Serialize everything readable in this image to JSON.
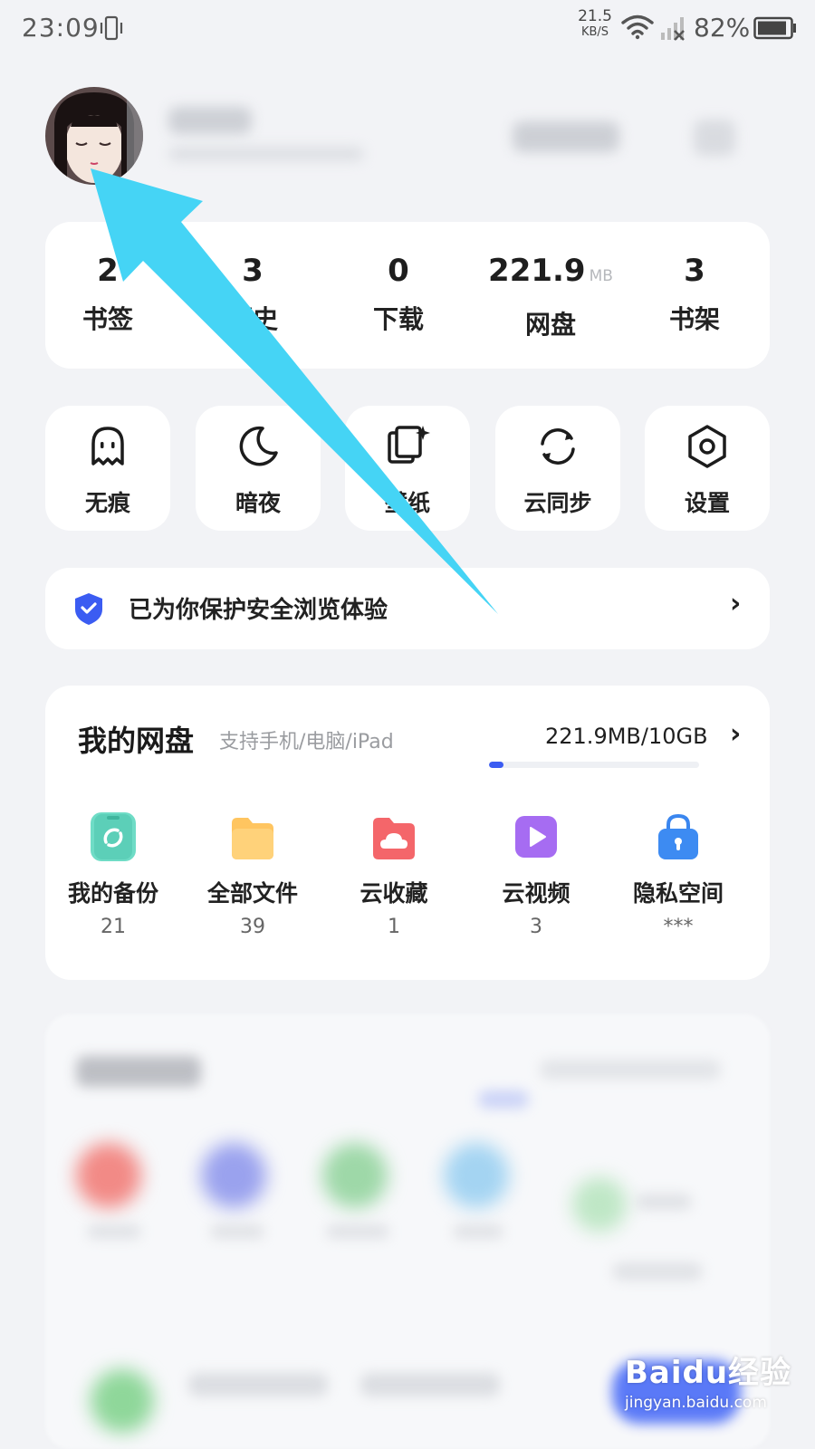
{
  "status_bar": {
    "time": "23:09",
    "net_speed_value": "21.5",
    "net_speed_unit": "KB/S",
    "battery": "82%"
  },
  "stats": [
    {
      "value": "2",
      "unit": "",
      "label": "书签"
    },
    {
      "value": "3",
      "unit": "",
      "label": "历史"
    },
    {
      "value": "0",
      "unit": "",
      "label": "下载"
    },
    {
      "value": "221.9",
      "unit": "MB",
      "label": "网盘"
    },
    {
      "value": "3",
      "unit": "",
      "label": "书架"
    }
  ],
  "tools": [
    {
      "label": "无痕",
      "icon": "ghost-icon"
    },
    {
      "label": "暗夜",
      "icon": "moon-icon"
    },
    {
      "label": "壁纸",
      "icon": "wallpaper-icon"
    },
    {
      "label": "云同步",
      "icon": "sync-icon"
    },
    {
      "label": "设置",
      "icon": "settings-hexagon-icon"
    }
  ],
  "safety": {
    "text": "已为你保护安全浏览体验",
    "chevron": "›",
    "accent": "#3b5cf2"
  },
  "cloud_disk": {
    "title": "我的网盘",
    "subtitle": "支持手机/电脑/iPad",
    "usage": "221.9MB/10GB",
    "usage_fraction": 0.0217,
    "chevron": "›",
    "items": [
      {
        "label": "我的备份",
        "count": "21",
        "icon": "phone-backup-icon",
        "color": "#5fd6c0"
      },
      {
        "label": "全部文件",
        "count": "39",
        "icon": "folder-icon",
        "color": "#ffc25a"
      },
      {
        "label": "云收藏",
        "count": "1",
        "icon": "cloud-collect-icon",
        "color": "#f25c60"
      },
      {
        "label": "云视频",
        "count": "3",
        "icon": "video-play-icon",
        "color": "#a86cf2"
      },
      {
        "label": "隐私空间",
        "count": "***",
        "icon": "lock-icon",
        "color": "#3d8bf2"
      }
    ]
  },
  "watermark": {
    "brand": "Baidu经验",
    "url": "jingyan.baidu.com"
  },
  "colors": {
    "background": "#f2f3f6",
    "arrow": "#45d4f5",
    "text_primary": "#222222"
  }
}
